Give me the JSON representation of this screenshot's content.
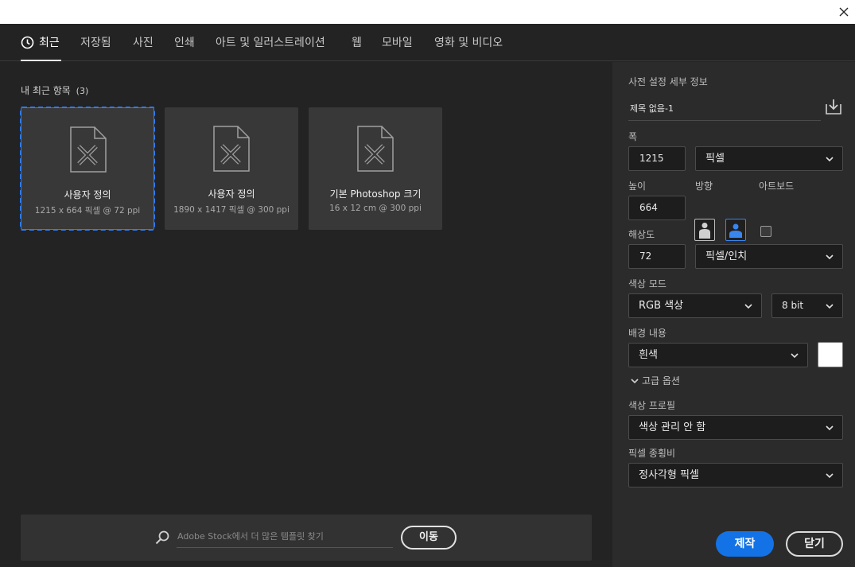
{
  "tabs": [
    {
      "label": "최근"
    },
    {
      "label": "저장됨"
    },
    {
      "label": "사진"
    },
    {
      "label": "인쇄"
    },
    {
      "label": "아트 및 일러스트레이션"
    },
    {
      "label": "웹"
    },
    {
      "label": "모바일"
    },
    {
      "label": "영화 및 비디오"
    }
  ],
  "recent": {
    "title": "내 최근 항목",
    "count": "(3)",
    "items": [
      {
        "title": "사용자 정의",
        "sub": "1215 x 664 픽셀 @ 72 ppi"
      },
      {
        "title": "사용자 정의",
        "sub": "1890 x 1417 픽셀 @ 300 ppi"
      },
      {
        "title": "기본 Photoshop 크기",
        "sub": "16 x 12 cm @ 300 ppi"
      }
    ]
  },
  "stock": {
    "placeholder": "Adobe Stock에서 더 많은 템플릿 찾기",
    "go_label": "이동"
  },
  "preset": {
    "section_title": "사전 설정 세부 정보",
    "name": "제목 없음-1",
    "width_label": "폭",
    "width_value": "1215",
    "width_unit": "픽셀",
    "height_label": "높이",
    "height_value": "664",
    "orientation_label": "방향",
    "artboard_label": "아트보드",
    "resolution_label": "해상도",
    "resolution_value": "72",
    "resolution_unit": "픽셀/인치",
    "color_mode_label": "색상 모드",
    "color_mode_value": "RGB 색상",
    "bit_depth_value": "8 bit",
    "background_label": "배경 내용",
    "background_value": "흰색",
    "background_color": "#ffffff",
    "advanced_label": "고급 옵션",
    "color_profile_label": "색상 프로필",
    "color_profile_value": "색상 관리 안 함",
    "pixel_aspect_label": "픽셀 종횡비",
    "pixel_aspect_value": "정사각형 픽셀",
    "create_label": "제작",
    "close_label": "닫기"
  },
  "colors": {
    "accent": "#1373e6",
    "selection": "#2f7bf0",
    "background": "#232323",
    "panel": "#2b2b2b"
  }
}
